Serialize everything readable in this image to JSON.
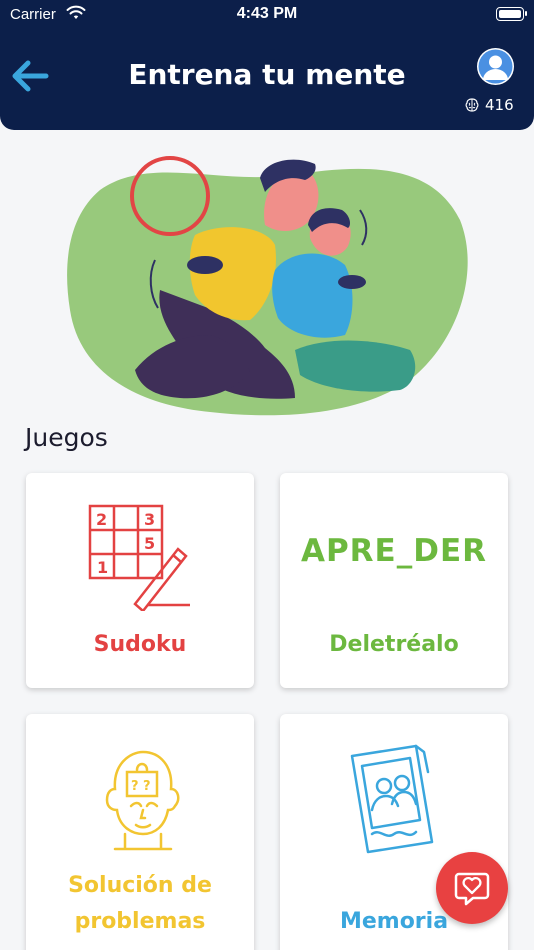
{
  "status_bar": {
    "carrier": "Carrier",
    "time": "4:43 PM"
  },
  "header": {
    "title": "Entrena tu mente",
    "points": "416",
    "back_icon": "arrow-left-icon",
    "avatar_icon": "user-avatar-icon",
    "points_icon": "brain-icon"
  },
  "section": {
    "title": "Juegos"
  },
  "games": [
    {
      "label": "Sudoku",
      "icon": "sudoku-grid-icon",
      "color": "#e34242"
    },
    {
      "label": "Deletréalo",
      "icon_text": "APRE_DER",
      "color": "#6cb83f"
    },
    {
      "label_line1": "Solución de",
      "label_line2": "problemas",
      "icon": "head-puzzle-icon",
      "color": "#f2c531"
    },
    {
      "label": "Memoria",
      "icon": "photo-memory-icon",
      "color": "#3aa6dd"
    }
  ],
  "fab": {
    "icon": "heart-chat-icon",
    "color": "#e84141"
  },
  "colors": {
    "header_bg": "#0c1f4a",
    "accent_blue": "#3aa6dd",
    "page_bg": "#f5f6f8"
  }
}
